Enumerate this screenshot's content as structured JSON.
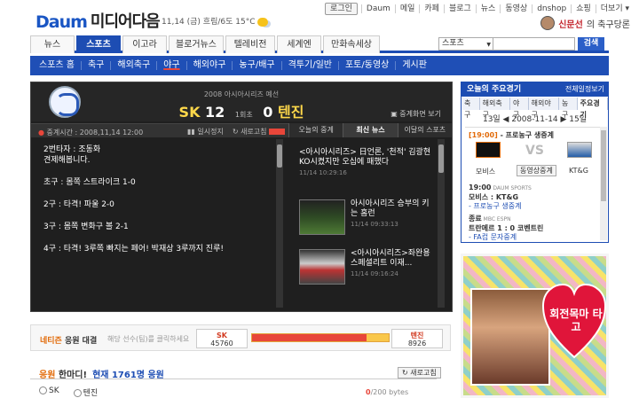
{
  "header": {
    "logo_mark": "Daum",
    "logo_text": "미디어다음",
    "date_weather": "11,14 (금) 흐림/6도 15°C",
    "top_nav": [
      "로그인",
      "Daum",
      "메일",
      "카페",
      "블로그",
      "뉴스",
      "동영상",
      "dnshop",
      "쇼핑",
      "더보기"
    ],
    "profile_name": "신문선",
    "profile_suffix": "의 축구당론"
  },
  "tabs": [
    "뉴스",
    "스포츠",
    "이고라",
    "블로거뉴스",
    "텔레비전",
    "세계엔",
    "만화속세상"
  ],
  "active_tab": "스포츠",
  "search": {
    "scope": "스포츠",
    "button": "검색"
  },
  "subnav": [
    "스포츠 홈",
    "축구",
    "해외축구",
    "야구",
    "해외야구",
    "농구/배구",
    "격투기/일반",
    "포토/동영상",
    "게시판"
  ],
  "active_subnav": "야구",
  "game": {
    "subtitle": "2008 아시아시리즈 예선",
    "home": "SK",
    "home_score": "12",
    "inning": "1회초",
    "away_score": "0",
    "away": "텐진",
    "replay": "중계화면 보기",
    "live_time": "중계시간 : 2008,11,14 12:00",
    "auto_scroll": "일시정지",
    "refresh": "새로고침",
    "panel_tabs": [
      "오늘의 중계",
      "최신 뉴스",
      "이달의 스포츠"
    ],
    "active_panel_tab": "최신 뉴스"
  },
  "commentary": [
    "2번타자 : 조동화\n견제해봅니다.",
    "초구 : 몸쪽 스트라이크 1-0",
    "2구 : 타격! 파울 2-0",
    "3구 : 몸쪽 변화구 볼 2-1",
    "4구 : 타격! 3루쪽 빠지는 페어! 박재상 3루까지 진루!"
  ],
  "news": [
    {
      "title": "<아시아시리즈> 日언론, '천적' 김광현 KO시켰지만 오십에 패했다",
      "time": "11/14 10:29:16"
    },
    {
      "title": "아시아시리즈 승부의 키는 홈런",
      "time": "11/14 09:33:13"
    },
    {
      "title": "<아시아시리즈>좌완용 스페셜리트 이재...",
      "time": "11/14 09:16:24"
    }
  ],
  "cheer": {
    "title_a": "네티즌",
    "title_b": " 응원 대결",
    "hint": "해당 선수(팀)를 클릭하세요",
    "team1": "SK",
    "team1_count": "45760",
    "team2": "텐진",
    "team2_count": "8926",
    "team1_share": 0.837
  },
  "comments": {
    "title_a": "응원",
    "title_b": " 한마디!",
    "count": "현재 1761명 응원",
    "refresh": "새로고침",
    "option1": "SK",
    "option2": "텐진",
    "bytes_used": "0",
    "bytes_max": "/200 bytes"
  },
  "side": {
    "title": "오늘의 주요경기",
    "more": "전체일정보기",
    "tabs": [
      "축구",
      "해외축구",
      "야구",
      "해외야구",
      "농구",
      "주요경기"
    ],
    "active_tab": "주요경기",
    "date": "13일 ◀ 2008-11-14 ▶ 15일",
    "match_title_time": "[19:00]",
    "match_title": " - 프로농구 생중계",
    "vs": "VS",
    "team1": "모비스",
    "team2": "KT&G",
    "match_btn": "동영상중계",
    "schedule": [
      {
        "time": "19:00",
        "src": "DAUM SPORTS",
        "title": "모비스 : KT&G",
        "sub": "- 프로농구 생중계"
      },
      {
        "time": "종료",
        "src": "MBC ESPN",
        "title": "트란메르 1 : 0 코벤트린",
        "sub": "- FA컵 문자중계"
      }
    ]
  },
  "ad": {
    "text": "회전목마 타고"
  },
  "colors": {
    "brand_blue": "#1d4db3",
    "accent_red": "#e8463a",
    "orange": "#e26b0a"
  }
}
